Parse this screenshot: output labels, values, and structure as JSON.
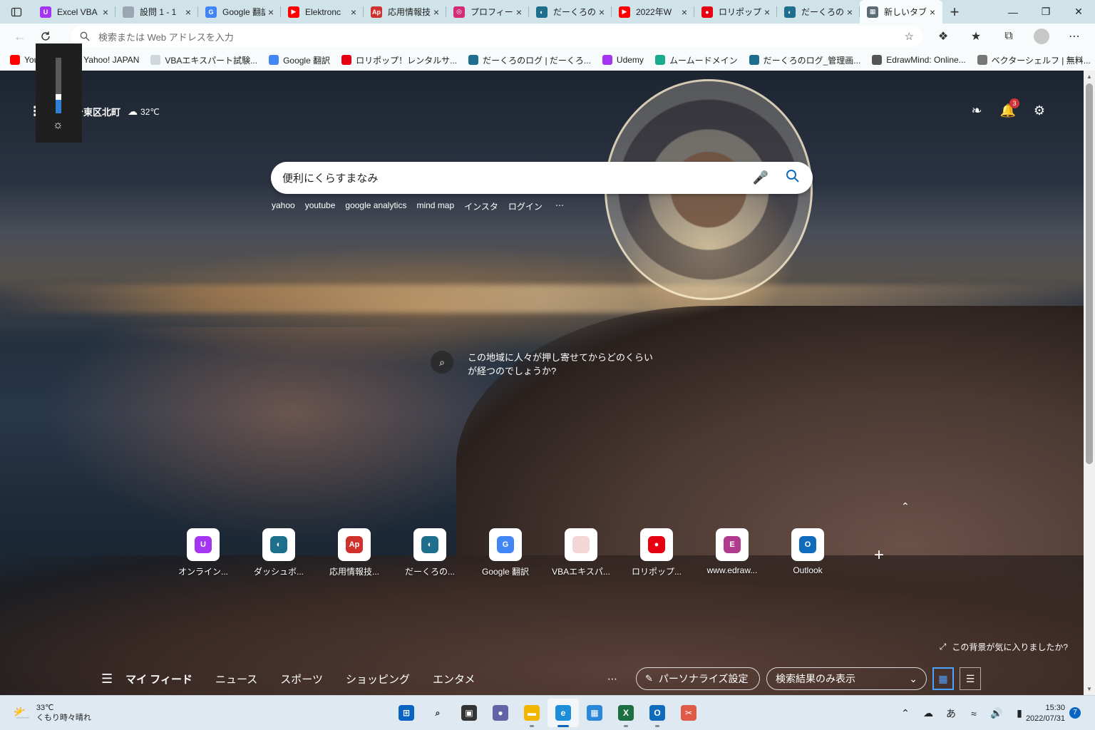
{
  "tabs": [
    {
      "title": "Excel VBA",
      "fav_color": "#a435f0",
      "fav_glyph": "U",
      "active": false
    },
    {
      "title": "設問 1 - 1",
      "fav_color": "#9aa7b0",
      "fav_glyph": "",
      "active": false
    },
    {
      "title": "Google 翻訳",
      "fav_color": "#4285f4",
      "fav_glyph": "G",
      "active": false
    },
    {
      "title": "Elektronc",
      "fav_color": "#ff0000",
      "fav_glyph": "▶",
      "active": false
    },
    {
      "title": "応用情報技",
      "fav_color": "#d0312d",
      "fav_glyph": "Ap",
      "active": false
    },
    {
      "title": "プロフィール",
      "fav_color": "#d62976",
      "fav_glyph": "◎",
      "active": false
    },
    {
      "title": "だーくろのロ",
      "fav_color": "#1e6e8e",
      "fav_glyph": "◐",
      "active": false
    },
    {
      "title": "2022年W",
      "fav_color": "#ff0000",
      "fav_glyph": "▶",
      "active": false
    },
    {
      "title": "ロリポップ",
      "fav_color": "#e60012",
      "fav_glyph": "●",
      "active": false
    },
    {
      "title": "だーくろのロ",
      "fav_color": "#1e6e8e",
      "fav_glyph": "◐",
      "active": false
    },
    {
      "title": "新しいタブ",
      "fav_color": "#5c6b73",
      "fav_glyph": "▦",
      "active": true
    }
  ],
  "address_bar": {
    "placeholder": "検索または Web アドレスを入力"
  },
  "bookmarks": [
    {
      "label": "YouTube",
      "color": "#ff0000"
    },
    {
      "label": "Yahoo! JAPAN",
      "color": "#ff0033"
    },
    {
      "label": "VBAエキスパート試験...",
      "color": "#cfd8dc"
    },
    {
      "label": "Google 翻訳",
      "color": "#4285f4"
    },
    {
      "label": "ロリポップ！レンタルサ...",
      "color": "#e60012"
    },
    {
      "label": "だーくろのログ | だーくろ...",
      "color": "#1e6e8e"
    },
    {
      "label": "Udemy",
      "color": "#a435f0"
    },
    {
      "label": "ムームードメイン",
      "color": "#1aab8a"
    },
    {
      "label": "だーくろのログ_管理画...",
      "color": "#1e6e8e"
    },
    {
      "label": "EdrawMind: Online...",
      "color": "#555555"
    },
    {
      "label": "ベクターシェルフ | 無料...",
      "color": "#777777"
    }
  ],
  "ntp": {
    "location": "台東区北町",
    "temperature": "32℃",
    "notifications_count": "3",
    "search_query": "便利にくらすまなみ",
    "quick_links": [
      "yahoo",
      "youtube",
      "google analytics",
      "mind map",
      "インスタ",
      "ログイン"
    ],
    "background_question": "この地域に人々が押し寄せてからどのくらいが経つのでしょうか?",
    "tiles": [
      {
        "label": "オンライン...",
        "color": "#a435f0",
        "glyph": "U"
      },
      {
        "label": "ダッシュボ...",
        "color": "#1e6e8e",
        "glyph": "◐"
      },
      {
        "label": "応用情報技...",
        "color": "#d0312d",
        "glyph": "Ap"
      },
      {
        "label": "だーくろの...",
        "color": "#1e6e8e",
        "glyph": "◐"
      },
      {
        "label": "Google 翻訳",
        "color": "#4285f4",
        "glyph": "G"
      },
      {
        "label": "VBAエキスパ...",
        "color": "#f3d6d6",
        "glyph": ""
      },
      {
        "label": "ロリポップ...",
        "color": "#e60012",
        "glyph": "●"
      },
      {
        "label": "www.edraw...",
        "color": "#b03a8c",
        "glyph": "E"
      },
      {
        "label": "Outlook",
        "color": "#0f6cbd",
        "glyph": "O"
      }
    ],
    "bg_like": "この背景が気に入りましたか?",
    "feed_tabs": [
      "マイ フィード",
      "ニュース",
      "スポーツ",
      "ショッピング",
      "エンタメ"
    ],
    "personalize_label": "パーソナライズ設定",
    "feed_filter": "検索結果のみ表示"
  },
  "brightness_level": 0.25,
  "taskbar": {
    "weather_temp": "33℃",
    "weather_text": "くもり時々晴れ",
    "apps": [
      {
        "name": "start",
        "color": "#0a64c2",
        "glyph": "⊞",
        "active": false,
        "running": false
      },
      {
        "name": "search",
        "color": "transparent",
        "glyph": "⌕",
        "active": false,
        "running": false
      },
      {
        "name": "task-view",
        "color": "#333333",
        "glyph": "▣",
        "active": false,
        "running": false
      },
      {
        "name": "teams-chat",
        "color": "#6264a7",
        "glyph": "●",
        "active": false,
        "running": false
      },
      {
        "name": "file-explorer",
        "color": "#f2b600",
        "glyph": "▬",
        "active": false,
        "running": true
      },
      {
        "name": "edge",
        "color": "#1d8fd8",
        "glyph": "e",
        "active": true,
        "running": true
      },
      {
        "name": "store",
        "color": "#2b88d8",
        "glyph": "▦",
        "active": false,
        "running": false
      },
      {
        "name": "excel",
        "color": "#1d6f42",
        "glyph": "X",
        "active": false,
        "running": true
      },
      {
        "name": "outlook",
        "color": "#0f6cbd",
        "glyph": "O",
        "active": false,
        "running": true
      },
      {
        "name": "snipping-tool",
        "color": "#e05a47",
        "glyph": "✂",
        "active": false,
        "running": false
      }
    ],
    "ime": "あ",
    "time": "15:30",
    "date": "2022/07/31",
    "notification_count": "7"
  }
}
